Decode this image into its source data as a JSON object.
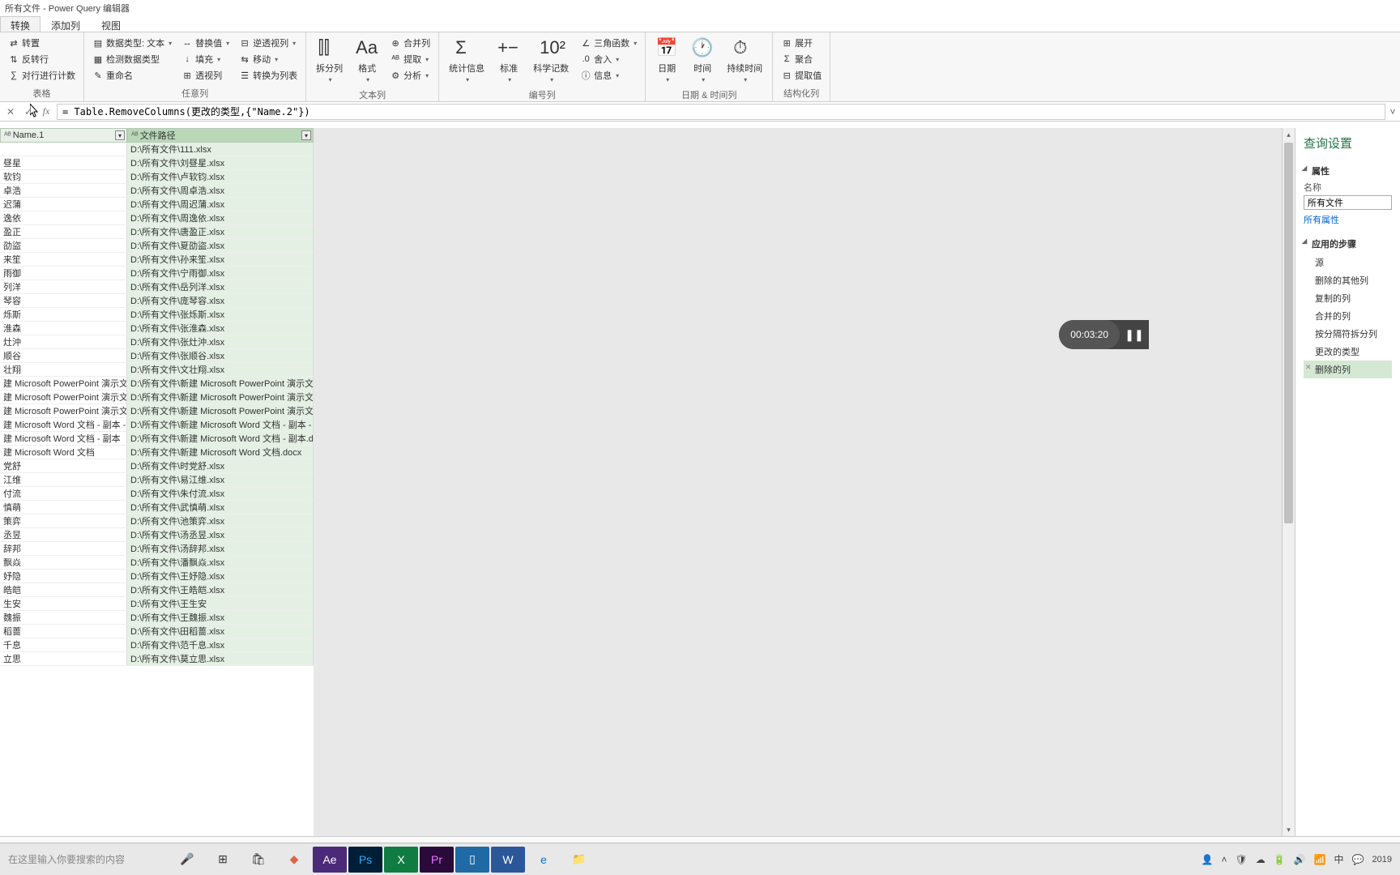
{
  "window": {
    "title": "所有文件 - Power Query 编辑器"
  },
  "tabs": [
    {
      "label": "转换",
      "active": true
    },
    {
      "label": "添加列",
      "active": false
    },
    {
      "label": "视图",
      "active": false
    }
  ],
  "ribbon": {
    "g1": {
      "label": "表格",
      "items": [
        "转置",
        "反转行",
        "对行进行计数"
      ]
    },
    "g2": {
      "label": "任意列",
      "datatype": "数据类型: 文本",
      "detect": "检测数据类型",
      "rename": "重命名",
      "replace": "替换值",
      "fill": "填充",
      "pivot": "透视列",
      "unpivot": "逆透视列",
      "move": "移动",
      "tolist": "转换为列表"
    },
    "g3": {
      "label": "文本列",
      "split": "拆分列",
      "format": "格式",
      "merge": "合并列",
      "extract": "提取",
      "parse": "分析"
    },
    "g4": {
      "label": "编号列",
      "stats": "统计信息",
      "standard": "标准",
      "sci": "科学记数",
      "trig": "三角函数",
      "round": "舍入",
      "info": "信息"
    },
    "g5": {
      "label": "日期 & 时间列",
      "date": "日期",
      "time": "时间",
      "duration": "持续时间"
    },
    "g6": {
      "label": "结构化列",
      "expand": "展开",
      "aggregate": "聚合",
      "extractval": "提取值"
    }
  },
  "formula": "= Table.RemoveColumns(更改的类型,{\"Name.2\"})",
  "columns": [
    {
      "name": "Name.1",
      "type": "ABC"
    },
    {
      "name": "文件路径",
      "type": "ABC"
    }
  ],
  "rows": [
    {
      "c1": "",
      "c2": "D:\\所有文件\\111.xlsx"
    },
    {
      "c1": "昼星",
      "c2": "D:\\所有文件\\刘昼星.xlsx"
    },
    {
      "c1": "软钧",
      "c2": "D:\\所有文件\\卢软钧.xlsx"
    },
    {
      "c1": "卓浩",
      "c2": "D:\\所有文件\\周卓浩.xlsx"
    },
    {
      "c1": "迟蒲",
      "c2": "D:\\所有文件\\周迟蒲.xlsx"
    },
    {
      "c1": "逸依",
      "c2": "D:\\所有文件\\周逸依.xlsx"
    },
    {
      "c1": "盈正",
      "c2": "D:\\所有文件\\唐盈正.xlsx"
    },
    {
      "c1": "劭盜",
      "c2": "D:\\所有文件\\夏劭盜.xlsx"
    },
    {
      "c1": "来笙",
      "c2": "D:\\所有文件\\孙来笙.xlsx"
    },
    {
      "c1": "雨御",
      "c2": "D:\\所有文件\\宁雨御.xlsx"
    },
    {
      "c1": "列洋",
      "c2": "D:\\所有文件\\岳列洋.xlsx"
    },
    {
      "c1": "琴容",
      "c2": "D:\\所有文件\\庞琴容.xlsx"
    },
    {
      "c1": "烁斯",
      "c2": "D:\\所有文件\\张烁斯.xlsx"
    },
    {
      "c1": "淮森",
      "c2": "D:\\所有文件\\张淮森.xlsx"
    },
    {
      "c1": "灶沖",
      "c2": "D:\\所有文件\\张灶沖.xlsx"
    },
    {
      "c1": "顺谷",
      "c2": "D:\\所有文件\\张顺谷.xlsx"
    },
    {
      "c1": "壮翔",
      "c2": "D:\\所有文件\\文壮翔.xlsx"
    },
    {
      "c1": "建 Microsoft PowerPoint 演示文稿 - ...",
      "c2": "D:\\所有文件\\新建 Microsoft PowerPoint 演示文稿 - ..."
    },
    {
      "c1": "建 Microsoft PowerPoint 演示文稿 - ...",
      "c2": "D:\\所有文件\\新建 Microsoft PowerPoint 演示文稿 - ..."
    },
    {
      "c1": "建 Microsoft PowerPoint 演示文稿",
      "c2": "D:\\所有文件\\新建 Microsoft PowerPoint 演示文稿.pptx"
    },
    {
      "c1": "建 Microsoft Word 文档 - 副本 - 副本",
      "c2": "D:\\所有文件\\新建 Microsoft Word 文档 - 副本 - 副本...."
    },
    {
      "c1": "建 Microsoft Word 文档 - 副本",
      "c2": "D:\\所有文件\\新建 Microsoft Word 文档 - 副本.docx"
    },
    {
      "c1": "建 Microsoft Word 文档",
      "c2": "D:\\所有文件\\新建 Microsoft Word 文档.docx"
    },
    {
      "c1": "党舒",
      "c2": "D:\\所有文件\\时党舒.xlsx"
    },
    {
      "c1": "江维",
      "c2": "D:\\所有文件\\易江维.xlsx"
    },
    {
      "c1": "付流",
      "c2": "D:\\所有文件\\朱付流.xlsx"
    },
    {
      "c1": "慎萌",
      "c2": "D:\\所有文件\\武慎萌.xlsx"
    },
    {
      "c1": "策弈",
      "c2": "D:\\所有文件\\池策弈.xlsx"
    },
    {
      "c1": "丞昱",
      "c2": "D:\\所有文件\\汤丞昱.xlsx"
    },
    {
      "c1": "辞邦",
      "c2": "D:\\所有文件\\汤辞邦.xlsx"
    },
    {
      "c1": "飘焱",
      "c2": "D:\\所有文件\\潘飘焱.xlsx"
    },
    {
      "c1": "妤隐",
      "c2": "D:\\所有文件\\王妤隐.xlsx"
    },
    {
      "c1": "皓皑",
      "c2": "D:\\所有文件\\王皓皑.xlsx"
    },
    {
      "c1": "生安",
      "c2": "D:\\所有文件\\王生安"
    },
    {
      "c1": "魏振",
      "c2": "D:\\所有文件\\王魏振.xlsx"
    },
    {
      "c1": "稻蔷",
      "c2": "D:\\所有文件\\田稻蔷.xlsx"
    },
    {
      "c1": "千息",
      "c2": "D:\\所有文件\\范千息.xlsx"
    },
    {
      "c1": "立思",
      "c2": "D:\\所有文件\\莫立思.xlsx"
    }
  ],
  "settings": {
    "title": "查询设置",
    "props_header": "属性",
    "name_label": "名称",
    "name_value": "所有文件",
    "all_props": "所有属性",
    "steps_header": "应用的步骤",
    "steps": [
      {
        "label": "源",
        "active": false
      },
      {
        "label": "删除的其他列",
        "active": false
      },
      {
        "label": "复制的列",
        "active": false
      },
      {
        "label": "合并的列",
        "active": false
      },
      {
        "label": "按分隔符拆分列",
        "active": false
      },
      {
        "label": "更改的类型",
        "active": false
      },
      {
        "label": "删除的列",
        "active": true
      }
    ]
  },
  "recorder": {
    "time": "00:03:20"
  },
  "taskbar": {
    "search_placeholder": "在这里输入你要搜索的内容",
    "tray_time": "2019",
    "tray_lang": "中"
  }
}
